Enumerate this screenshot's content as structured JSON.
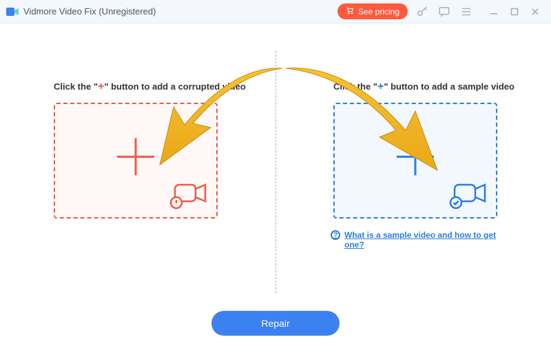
{
  "window": {
    "title": "Vidmore Video Fix (Unregistered)"
  },
  "header": {
    "pricing_label": "See pricing",
    "icons": {
      "key": "key-icon",
      "chat": "chat-icon",
      "menu": "menu-icon"
    }
  },
  "left_panel": {
    "label_prefix": "Click the \"",
    "label_suffix": "\" button to add a corrupted video",
    "plus_symbol": "+"
  },
  "right_panel": {
    "label_prefix": "Click the \"",
    "label_suffix": "\" button to add a sample video",
    "plus_symbol": "+"
  },
  "help": {
    "text": "What is a sample video and how to get one?"
  },
  "actions": {
    "repair_label": "Repair"
  }
}
